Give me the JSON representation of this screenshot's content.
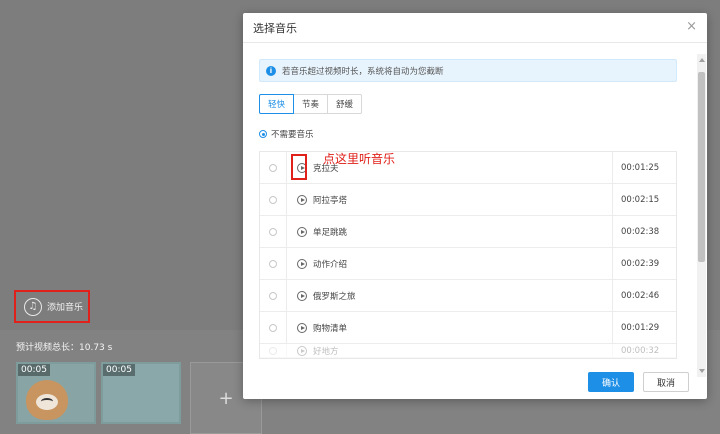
{
  "background": {
    "add_music_label": "添加音乐",
    "total_length_label": "预计视频总长：10.73 s",
    "clips": [
      {
        "duration": "00:05"
      },
      {
        "duration": "00:05"
      }
    ],
    "add_clip_label": "+"
  },
  "modal": {
    "title": "选择音乐",
    "close_label": "×",
    "alert_text": "若音乐超过视频时长，系统将自动为您截断",
    "info_icon_glyph": "i",
    "tabs": [
      {
        "label": "轻快",
        "active": true
      },
      {
        "label": "节奏",
        "active": false
      },
      {
        "label": "舒缓",
        "active": false
      }
    ],
    "no_music_label": "不需要音乐",
    "annotation": "点这里听音乐",
    "tracks": [
      {
        "name": "克拉夫",
        "time": "00:01:25"
      },
      {
        "name": "阿拉亭塔",
        "time": "00:02:15"
      },
      {
        "name": "单足跳跳",
        "time": "00:02:38"
      },
      {
        "name": "动作介绍",
        "time": "00:02:39"
      },
      {
        "name": "俄罗斯之旅",
        "time": "00:02:46"
      },
      {
        "name": "购物清单",
        "time": "00:01:29"
      },
      {
        "name": "好地方",
        "time": "00:00:32"
      }
    ],
    "ok_label": "确认",
    "cancel_label": "取消"
  },
  "colors": {
    "accent": "#1e8fe6",
    "annotation_red": "#e0201a"
  }
}
